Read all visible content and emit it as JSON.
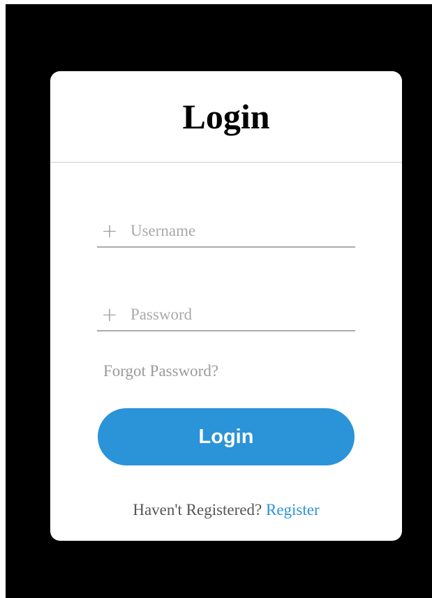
{
  "login_card": {
    "title": "Login",
    "username_field": {
      "icon": "plus-icon",
      "icon_glyph": "+",
      "placeholder": "Username",
      "value": ""
    },
    "password_field": {
      "icon": "plus-icon",
      "icon_glyph": "+",
      "placeholder": "Password",
      "value": ""
    },
    "forgot_password_label": "Forgot Password?",
    "login_button_label": "Login",
    "register_prompt": "Haven't Registered?",
    "register_link_label": "Register"
  },
  "colors": {
    "background": "#000000",
    "card": "#ffffff",
    "accent": "#2b93d8",
    "muted_text": "#9a9a9a",
    "underline": "#aaaaaa"
  }
}
